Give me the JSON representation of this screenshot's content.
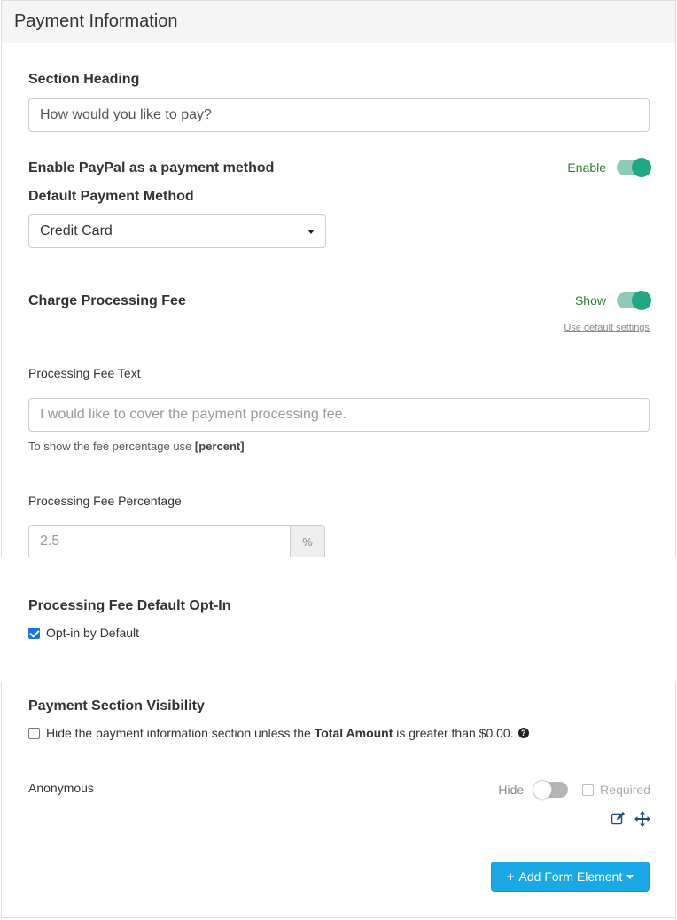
{
  "panel": {
    "title": "Payment Information"
  },
  "section_heading": {
    "label": "Section Heading",
    "value": "How would you like to pay?"
  },
  "paypal": {
    "label": "Enable PayPal as a payment method",
    "toggle_label": "Enable",
    "toggle_on": true
  },
  "default_payment": {
    "label": "Default Payment Method",
    "selected": "Credit Card"
  },
  "processing_fee": {
    "label": "Charge Processing Fee",
    "toggle_label": "Show",
    "toggle_on": true,
    "default_link": "Use default settings",
    "text_label": "Processing Fee Text",
    "text_placeholder": "I would like to cover the payment processing fee.",
    "help_prefix": "To show the fee percentage use",
    "help_token": "[percent]",
    "percentage_label": "Processing Fee Percentage",
    "percentage_placeholder": "2.5",
    "percentage_addon": "%"
  },
  "opt_in": {
    "label": "Processing Fee Default Opt-In",
    "checkbox_label": "Opt-in by Default",
    "checked": true
  },
  "visibility": {
    "label": "Payment Section Visibility",
    "text_before": "Hide the payment information section unless the",
    "text_bold": "Total Amount",
    "text_after": "is greater than $0.00.",
    "checked": false
  },
  "anonymous": {
    "label": "Anonymous",
    "toggle_label": "Hide",
    "toggle_on": false,
    "required_label": "Required"
  },
  "add_button": {
    "label": "Add Form Element"
  },
  "colors": {
    "toggle_on": "#20a884",
    "button": "#1aa9e6",
    "icon": "#1f4e79"
  }
}
